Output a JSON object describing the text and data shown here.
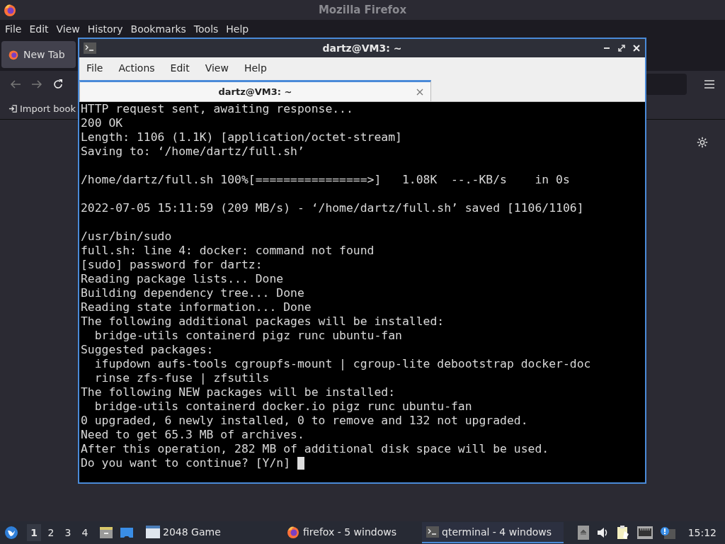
{
  "browser": {
    "title": "Mozilla Firefox",
    "menu": [
      "File",
      "Edit",
      "View",
      "History",
      "Bookmarks",
      "Tools",
      "Help"
    ],
    "tabs": [
      {
        "label": "New Tab",
        "selected": true
      }
    ],
    "bookmarks_bar": {
      "import_label": "Import book"
    }
  },
  "terminal": {
    "title": "dartz@VM3: ~",
    "menu": [
      "File",
      "Actions",
      "Edit",
      "View",
      "Help"
    ],
    "tabs": [
      {
        "label": "dartz@VM3: ~",
        "selected": true
      }
    ],
    "output": [
      [
        "HTTP request sent, awaiting response...",
        "200 OK",
        "Length: 1106 (1.1K) [application/octet-stream]",
        "Saving to: ‘/home/dartz/full.sh’"
      ],
      [
        "/home/dartz/full.sh 100%[================>]   1.08K  --.-KB/s    in 0s"
      ],
      [
        "2022-07-05 15:11:59 (209 MB/s) - ‘/home/dartz/full.sh’ saved [1106/1106]"
      ],
      [
        "/usr/bin/sudo",
        "full.sh: line 4: docker: command not found",
        "[sudo] password for dartz:",
        "Reading package lists... Done",
        "Building dependency tree... Done",
        "Reading state information... Done",
        "The following additional packages will be installed:",
        "  bridge-utils containerd pigz runc ubuntu-fan",
        "Suggested packages:",
        "  ifupdown aufs-tools cgroupfs-mount | cgroup-lite debootstrap docker-doc",
        "  rinse zfs-fuse | zfsutils",
        "The following NEW packages will be installed:",
        "  bridge-utils containerd docker.io pigz runc ubuntu-fan",
        "0 upgraded, 6 newly installed, 0 to remove and 132 not upgraded.",
        "Need to get 65.3 MB of archives.",
        "After this operation, 282 MB of additional disk space will be used.",
        "Do you want to continue? [Y/n] "
      ]
    ]
  },
  "taskbar": {
    "desktops": [
      {
        "label": "1",
        "selected": true
      },
      {
        "label": "2",
        "selected": false
      },
      {
        "label": "3",
        "selected": false
      },
      {
        "label": "4",
        "selected": false
      }
    ],
    "tasks": [
      {
        "label": "2048 Game",
        "kind": "window",
        "selected": false
      },
      {
        "label": "firefox - 5 windows",
        "kind": "firefox",
        "selected": false
      },
      {
        "label": "qterminal - 4 windows",
        "kind": "terminal",
        "selected": true
      }
    ],
    "clock": "15:12"
  }
}
